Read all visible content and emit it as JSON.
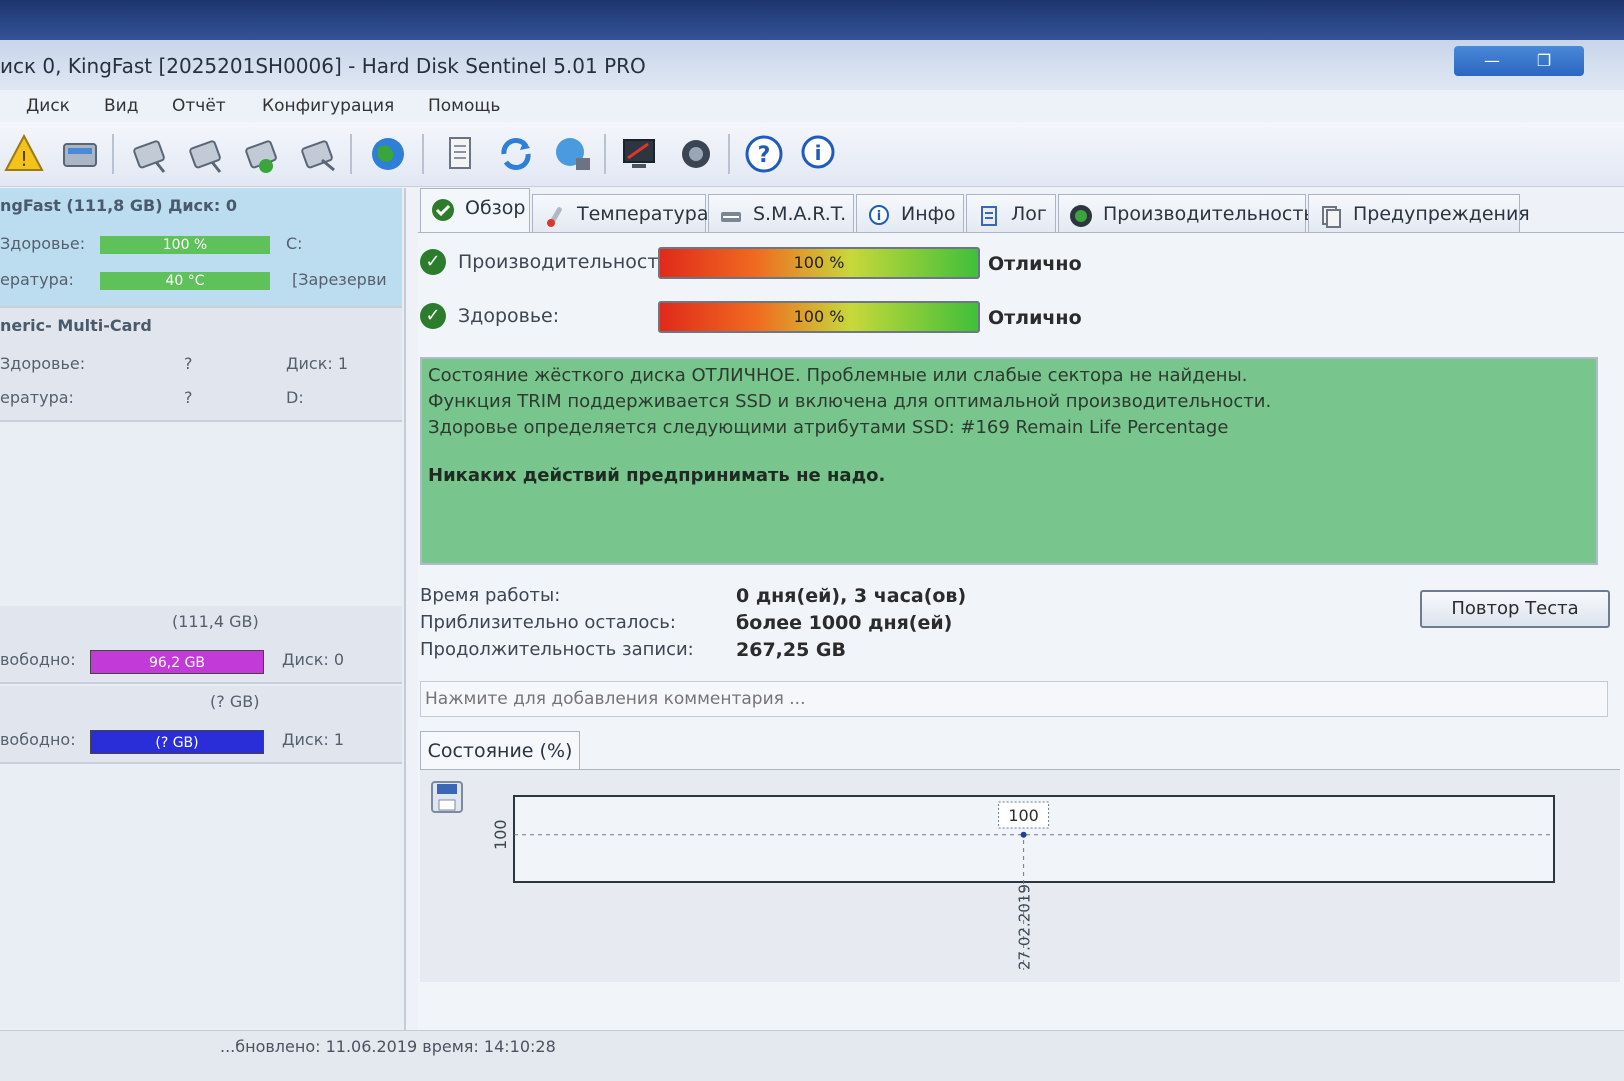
{
  "window": {
    "title": "иск 0, KingFast [2025201SH0006] - Hard Disk Sentinel 5.01 PRO",
    "controls": [
      "minimize",
      "restore"
    ]
  },
  "menu": [
    "Диск",
    "Вид",
    "Отчёт",
    "Конфигурация",
    "Помощь"
  ],
  "toolbar_icons": [
    "warning-icon",
    "disk-icon",
    "disk-test-icon",
    "disk-surface-icon",
    "disk-ok-icon",
    "disk-erase-icon",
    "globe-icon",
    "document-icon",
    "refresh-icon",
    "network-icon",
    "monitor-icon",
    "speaker-icon",
    "help-icon",
    "info-icon"
  ],
  "sidebar": {
    "disks": [
      {
        "header": "ngFast (111,8 GB) Диск: 0",
        "health_label": "Здоровье:",
        "health_value": "100 %",
        "health_percent": 100,
        "health_drive": "C:",
        "temp_label": "ература:",
        "temp_value": "40 °C",
        "temp_drive": "[Зарезерви"
      },
      {
        "header": "neric- Multi-Card",
        "health_label": "Здоровье:",
        "health_value": "?",
        "health_drive": "Диск: 1",
        "temp_label": "ература:",
        "temp_value": "?",
        "temp_drive": "D:"
      }
    ],
    "volumes": [
      {
        "size": "(111,4 GB)",
        "free_label": "вободно:",
        "free_value": "96,2 GB",
        "disk": "Диск: 0",
        "color": "#c23ad8"
      },
      {
        "size": "(? GB)",
        "free_label": "вободно:",
        "free_value": "(? GB)",
        "disk": "Диск: 1",
        "color": "#2a2ed8"
      }
    ]
  },
  "tabs": [
    {
      "label": "Обзор",
      "icon": "check-icon",
      "active": true
    },
    {
      "label": "Температура",
      "icon": "thermometer-icon"
    },
    {
      "label": "S.M.A.R.T.",
      "icon": "smart-icon"
    },
    {
      "label": "Инфо",
      "icon": "info-icon"
    },
    {
      "label": "Лог",
      "icon": "log-icon"
    },
    {
      "label": "Производительность",
      "icon": "performance-icon"
    },
    {
      "label": "Предупреждения",
      "icon": "warnings-icon"
    }
  ],
  "overview": {
    "performance_label": "Производительность:",
    "performance_value": "100 %",
    "performance_percent": 100,
    "performance_rating": "Отлично",
    "health_label": "Здоровье:",
    "health_value": "100 %",
    "health_percent": 100,
    "health_rating": "Отлично",
    "status_lines": [
      "Состояние жёсткого диска ОТЛИЧНОЕ. Проблемные или слабые сектора не найдены.",
      "Функция TRIM поддерживается SSD и включена для оптимальной производительности.",
      "Здоровье определяется следующими атрибутами SSD: #169 Remain Life Percentage"
    ],
    "action_text": "Никаких действий предпринимать не надо.",
    "uptime_label": "Время работы:",
    "uptime_value": "0 дня(ей), 3 часа(ов)",
    "remaining_label": "Приблизительно осталось:",
    "remaining_value": "более 1000 дня(ей)",
    "writes_label": "Продолжительность записи:",
    "writes_value": "267,25 GB",
    "retest_button": "Повтор Теста",
    "comment_placeholder": "Нажмите для добавления комментария ..."
  },
  "chart": {
    "tab_label": "Состояние (%)"
  },
  "chart_data": {
    "type": "line",
    "x": [
      "27.02.2019"
    ],
    "series": [
      {
        "values": [
          100
        ]
      }
    ],
    "ytick": "100",
    "data_label": "100"
  },
  "statusbar": {
    "text": "...бновлено: 11.06.2019 время: 14:10:28"
  }
}
